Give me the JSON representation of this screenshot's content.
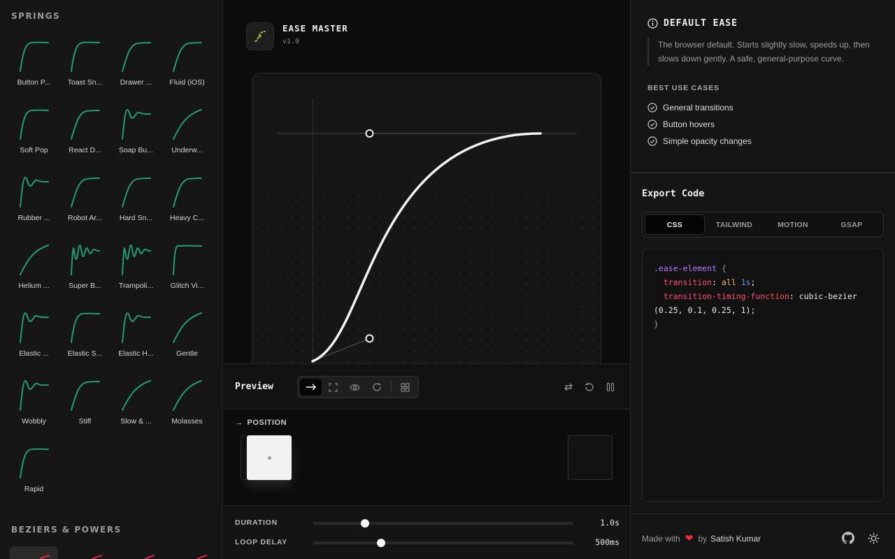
{
  "sidebar": {
    "springs_title": "SPRINGS",
    "beziers_title": "BEZIERS & POWERS",
    "curve_color": "#1f9e74",
    "bezier_color": "#d9264a",
    "springs": [
      {
        "label": "Button P...",
        "shape": "overshoot"
      },
      {
        "label": "Toast Sn...",
        "shape": "overshoot"
      },
      {
        "label": "Drawer ...",
        "shape": "smooth"
      },
      {
        "label": "Fluid (iOS)",
        "shape": "smooth"
      },
      {
        "label": "Soft Pop",
        "shape": "overshoot"
      },
      {
        "label": "React D...",
        "shape": "smooth"
      },
      {
        "label": "Soap Bu...",
        "shape": "wobble"
      },
      {
        "label": "Underw...",
        "shape": "slow"
      },
      {
        "label": "Rubber ...",
        "shape": "wobble"
      },
      {
        "label": "Robot Ar...",
        "shape": "smooth"
      },
      {
        "label": "Hard Sn...",
        "shape": "smooth"
      },
      {
        "label": "Heavy C...",
        "shape": "smooth"
      },
      {
        "label": "Helium ...",
        "shape": "slow"
      },
      {
        "label": "Super B...",
        "shape": "bouncy"
      },
      {
        "label": "Trampoli...",
        "shape": "bouncy"
      },
      {
        "label": "Glitch Vi...",
        "shape": "snap"
      },
      {
        "label": "Elastic ...",
        "shape": "wobble"
      },
      {
        "label": "Elastic S...",
        "shape": "overshoot"
      },
      {
        "label": "Elastic H...",
        "shape": "wobble"
      },
      {
        "label": "Gentle",
        "shape": "slow"
      },
      {
        "label": "Wobbly",
        "shape": "wobble"
      },
      {
        "label": "Stiff",
        "shape": "smooth"
      },
      {
        "label": "Slow & ...",
        "shape": "slow"
      },
      {
        "label": "Molasses",
        "shape": "slow"
      },
      {
        "label": "Rapid",
        "shape": "overshoot"
      }
    ]
  },
  "app": {
    "title": "EASE MASTER",
    "version": "v1.0",
    "accent": "#a3c93a"
  },
  "editor": {
    "bezier": [
      0.25,
      0.1,
      0.25,
      1
    ],
    "curve_color": "#f2f2f2"
  },
  "preview": {
    "title": "Preview",
    "modes": [
      "arrow-right-icon",
      "expand-icon",
      "eye-icon",
      "rotate-icon",
      "grid-icon"
    ],
    "active_mode": 0,
    "stage_arrow": "→",
    "stage_label": "POSITION"
  },
  "sliders": {
    "duration": {
      "label": "DURATION",
      "value": "1.0s",
      "fraction": 0.2
    },
    "loop_delay": {
      "label": "LOOP DELAY",
      "value": "500ms",
      "fraction": 0.26
    }
  },
  "info": {
    "title": "DEFAULT EASE",
    "description": "The browser default. Starts slightly slow, speeds up, then slows down gently. A safe, general-purpose curve.",
    "best_title": "BEST USE CASES",
    "use_cases": [
      "General transitions",
      "Button hovers",
      "Simple opacity changes"
    ]
  },
  "export": {
    "title": "Export Code",
    "tabs": [
      "CSS",
      "TAILWIND",
      "MOTION",
      "GSAP"
    ],
    "active_tab": 0,
    "code": {
      "selector": ".ease-element",
      "open": "{",
      "prop1": "transition",
      "v_all": "all",
      "v_dur": "1s",
      "prop2": "transition-timing-function",
      "fn": "cubic-bezier",
      "args": "(0.25, 0.1, 0.25, 1);",
      "close": "}"
    }
  },
  "footer": {
    "made_with": "Made with",
    "heart": "❤",
    "by": "by",
    "author": "Satish Kumar"
  }
}
